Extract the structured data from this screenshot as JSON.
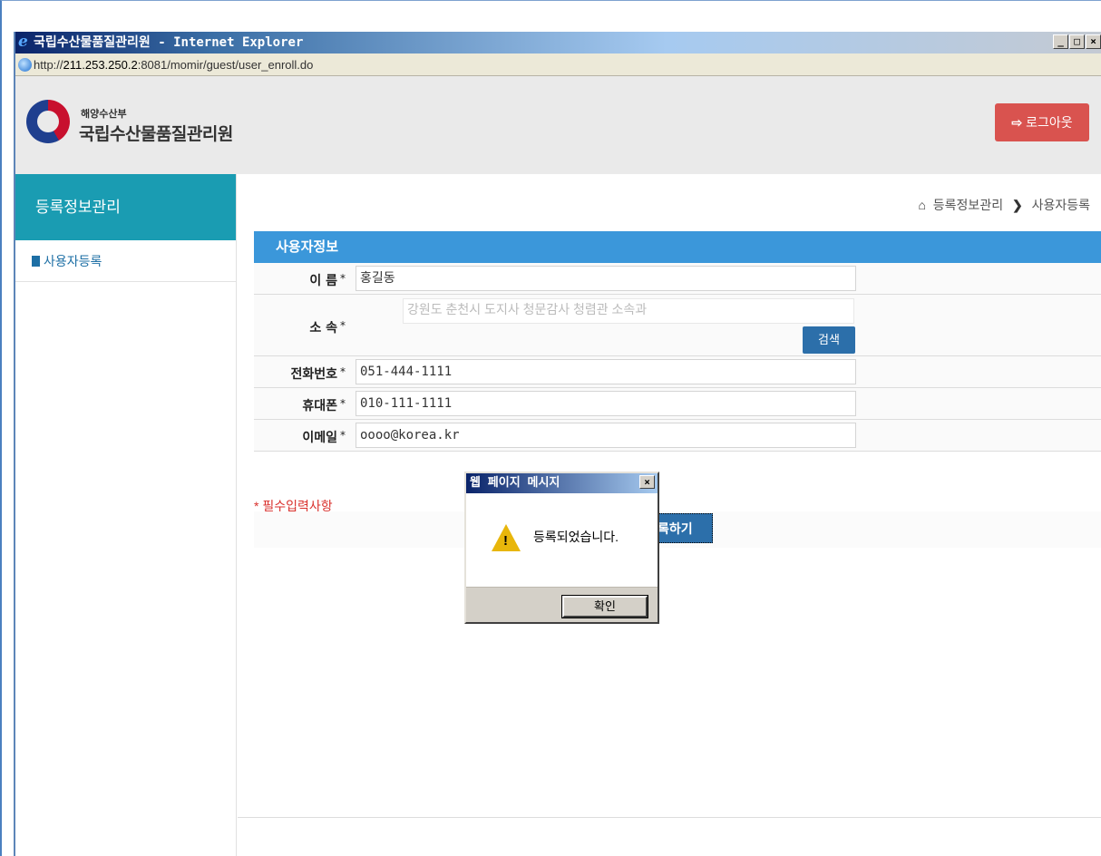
{
  "browser": {
    "title": "국립수산물품질관리원 - Internet Explorer",
    "url_prefix": "http://",
    "url_host": "211.253.250.2",
    "url_rest": ":8081/momir/guest/user_enroll.do",
    "controls": [
      "_",
      "□",
      "×"
    ]
  },
  "header": {
    "org_sub": "해양수산부",
    "org_name": "국립수산물품질관리원",
    "logout_label": "로그아웃",
    "logout_icon": "logout-arrow"
  },
  "sidebar": {
    "heading": "등록정보관리",
    "items": [
      {
        "label": "사용자등록",
        "icon": "document-icon"
      }
    ]
  },
  "breadcrumb": {
    "level1": "등록정보관리",
    "separator": "❯",
    "level2": "사용자등록"
  },
  "form": {
    "heading": "사용자정보",
    "fields": [
      {
        "label": "이 름",
        "value": "홍길동"
      },
      {
        "label": "소 속",
        "value": "강원도 춘천시 도지사 청문감사 청렴관 소속과",
        "search_label": "검색"
      },
      {
        "label": "전화번호",
        "value": "051-444-1111"
      },
      {
        "label": "휴대폰",
        "value": "010-111-1111"
      },
      {
        "label": "이메일",
        "value": "oooo@korea.kr"
      }
    ],
    "required_mark": "*",
    "required_note": "* 필수입력사항",
    "register_label": "록하기"
  },
  "dialog": {
    "title": "웹 페이지 메시지",
    "close": "×",
    "message": "등록되었습니다.",
    "ok_label": "확인",
    "icon": "warning-icon"
  },
  "colors": {
    "accent_teal": "#1a9cb2",
    "header_blue": "#3b97da",
    "button_blue": "#2c6faa",
    "logout_red": "#d9534f",
    "required_red": "#d9302c"
  }
}
